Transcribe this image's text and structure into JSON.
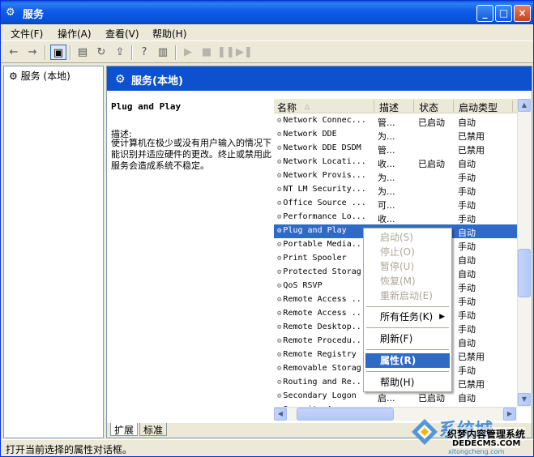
{
  "window": {
    "title": "服务",
    "controls": [
      "_",
      "□",
      "×"
    ]
  },
  "menu": [
    "文件(F)",
    "操作(A)",
    "查看(V)",
    "帮助(H)"
  ],
  "toolbar": {
    "back": "←",
    "forward": "→",
    "console_tree": "▣",
    "properties": "▤",
    "refresh": "↻",
    "export": "⇪",
    "help": "?",
    "view": "▥",
    "play": "▶",
    "stop": "■",
    "pause": "❚❚",
    "restart": "▶❚"
  },
  "tree": {
    "root": "服务 (本地)"
  },
  "panel": {
    "header": "服务(本地)"
  },
  "description": {
    "service": "Plug and Play",
    "label": "描述:",
    "text": "使计算机在极少或没有用户输入的情况下能识别并适应硬件的更改。终止或禁用此服务会造成系统不稳定。"
  },
  "columns": {
    "name": "名称",
    "sort": "△",
    "desc": "描述",
    "status": "状态",
    "startup": "启动类型"
  },
  "services": [
    {
      "name": "Network Connec...",
      "desc": "管...",
      "status": "已启动",
      "startup": "自动"
    },
    {
      "name": "Network DDE",
      "desc": "为...",
      "status": "",
      "startup": "已禁用"
    },
    {
      "name": "Network DDE DSDM",
      "desc": "管...",
      "status": "",
      "startup": "已禁用"
    },
    {
      "name": "Network Locati...",
      "desc": "收...",
      "status": "已启动",
      "startup": "自动"
    },
    {
      "name": "Network Provis...",
      "desc": "为...",
      "status": "",
      "startup": "手动"
    },
    {
      "name": "NT LM Security...",
      "desc": "为...",
      "status": "",
      "startup": "手动"
    },
    {
      "name": "Office Source ...",
      "desc": "可...",
      "status": "",
      "startup": "手动"
    },
    {
      "name": "Performance Lo...",
      "desc": "收...",
      "status": "",
      "startup": "手动"
    },
    {
      "name": "Plug and Play",
      "desc": "",
      "status": "",
      "startup": "自动"
    },
    {
      "name": "Portable Media...",
      "desc": "",
      "status": "",
      "startup": "手动"
    },
    {
      "name": "Print Spooler",
      "desc": "",
      "status": "",
      "startup": "自动"
    },
    {
      "name": "Protected Storag",
      "desc": "",
      "status": "",
      "startup": "自动"
    },
    {
      "name": "QoS RSVP",
      "desc": "",
      "status": "",
      "startup": "手动"
    },
    {
      "name": "Remote Access ...",
      "desc": "",
      "status": "",
      "startup": "手动"
    },
    {
      "name": "Remote Access ...",
      "desc": "",
      "status": "",
      "startup": "手动"
    },
    {
      "name": "Remote Desktop...",
      "desc": "",
      "status": "",
      "startup": "手动"
    },
    {
      "name": "Remote Procedu...",
      "desc": "",
      "status": "",
      "startup": "自动"
    },
    {
      "name": "Remote Registry",
      "desc": "",
      "status": "",
      "startup": "已禁用"
    },
    {
      "name": "Removable Storag",
      "desc": "",
      "status": "",
      "startup": "手动"
    },
    {
      "name": "Routing and Re...",
      "desc": "",
      "status": "",
      "startup": "已禁用"
    },
    {
      "name": "Secondary Logon",
      "desc": "启...",
      "status": "已启动",
      "startup": "自动"
    },
    {
      "name": "Security A...",
      "desc": "",
      "status": "已启动",
      "startup": "自动"
    }
  ],
  "selected_index": 8,
  "context_menu": {
    "start": "启动(S)",
    "stop": "停止(O)",
    "pause": "暂停(U)",
    "resume": "恢复(M)",
    "restart": "重新启动(E)",
    "all_tasks": "所有任务(K)",
    "refresh": "刷新(F)",
    "properties": "属性(R)",
    "help": "帮助(H)"
  },
  "tabs": {
    "extended": "扩展",
    "standard": "标准"
  },
  "status_text": "打开当前选择的属性对话框。",
  "watermark": {
    "brand": "系统城",
    "line1": "织梦内容管理系统",
    "line2": "DEDECMS.COM",
    "line3": "xitongcheng.com"
  }
}
